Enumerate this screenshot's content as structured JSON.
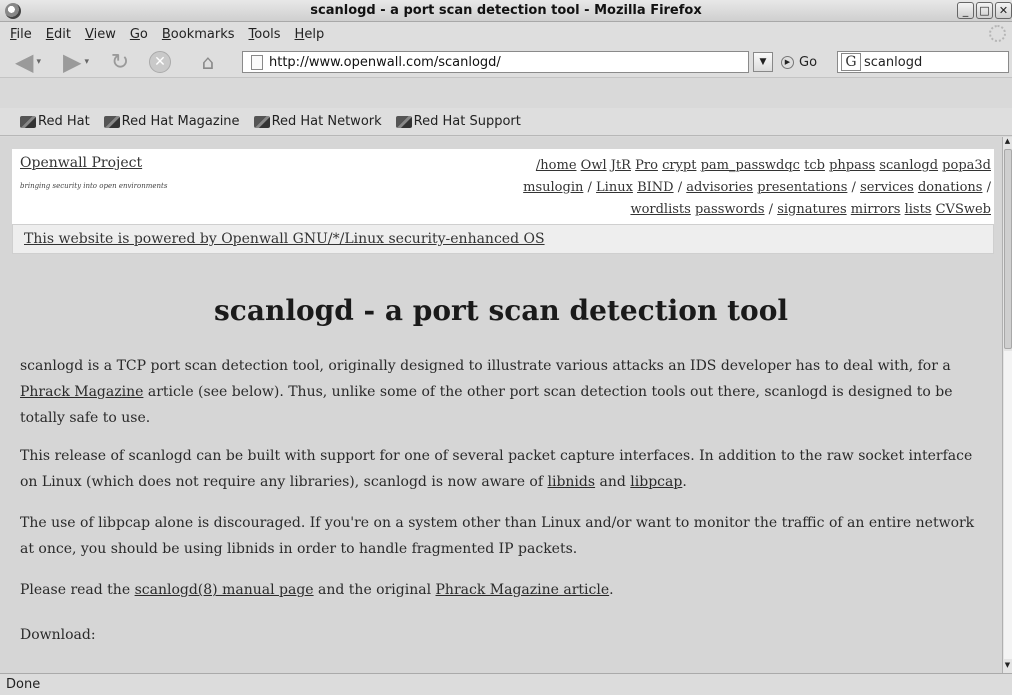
{
  "window": {
    "title": "scanlogd - a port scan detection tool - Mozilla Firefox",
    "buttons": {
      "minimize": "_",
      "maximize": "□",
      "close": "✕"
    }
  },
  "menubar": {
    "items": [
      {
        "mnemonic": "F",
        "rest": "ile"
      },
      {
        "mnemonic": "E",
        "rest": "dit"
      },
      {
        "mnemonic": "V",
        "rest": "iew"
      },
      {
        "mnemonic": "G",
        "rest": "o"
      },
      {
        "mnemonic": "B",
        "rest": "ookmarks"
      },
      {
        "mnemonic": "T",
        "rest": "ools"
      },
      {
        "mnemonic": "H",
        "rest": "elp"
      }
    ]
  },
  "navbar": {
    "back_icon": "◀",
    "forward_icon": "▶",
    "dropdown_icon": "▾",
    "reload_icon": "↻",
    "stop_icon": "✕",
    "home_icon": "⌂",
    "url": "http://www.openwall.com/scanlogd/",
    "url_dropdown": "▼",
    "go_icon": "▶",
    "go_label": "Go",
    "search_engine": "G",
    "search_value": "scanlogd"
  },
  "bookmarks": [
    {
      "label": "Red Hat"
    },
    {
      "label": "Red Hat Magazine"
    },
    {
      "label": "Red Hat Network"
    },
    {
      "label": "Red Hat Support"
    }
  ],
  "page": {
    "site_name": "Openwall Project",
    "tagline": "bringing security into open environments",
    "nav_line1": [
      "/home",
      "Owl",
      "JtR",
      "Pro",
      "crypt",
      "pam_passwdqc",
      "tcb",
      "phpass",
      "scanlogd",
      "popa3d"
    ],
    "nav_line2": [
      "msulogin",
      "/",
      "Linux",
      "BIND",
      "/",
      "advisories",
      "presentations",
      "/",
      "services",
      "donations",
      "/"
    ],
    "nav_line3": [
      "wordlists",
      "passwords",
      "/",
      "signatures",
      "mirrors",
      "lists",
      "CVSweb"
    ],
    "powered_by": "This website is powered by Openwall GNU/*/Linux security-enhanced OS",
    "title": "scanlogd - a port scan detection tool",
    "p1": {
      "before": "scanlogd is a TCP port scan detection tool, originally designed to illustrate various attacks an IDS developer has to deal with, for a ",
      "link": "Phrack Magazine",
      "after": " article (see below). Thus, unlike some of the other port scan detection tools out there, scanlogd is designed to be totally safe to use."
    },
    "p2": {
      "before": "This release of scanlogd can be built with support for one of several packet capture interfaces. In addition to the raw socket interface on Linux (which does not require any libraries), scanlogd is now aware of ",
      "link1": "libnids",
      "mid": " and ",
      "link2": "libpcap",
      "after": "."
    },
    "p3": "The use of libpcap alone is discouraged. If you're on a system other than Linux and/or want to monitor the traffic of an entire network at once, you should be using libnids in order to handle fragmented IP packets.",
    "p4": {
      "before": "Please read the ",
      "link1": "scanlogd(8) manual page",
      "mid": " and the original ",
      "link2": "Phrack Magazine article",
      "after": "."
    },
    "p5": "Download:"
  },
  "scrollbar": {
    "up_icon": "▲",
    "down_icon": "▼"
  },
  "status": "Done"
}
